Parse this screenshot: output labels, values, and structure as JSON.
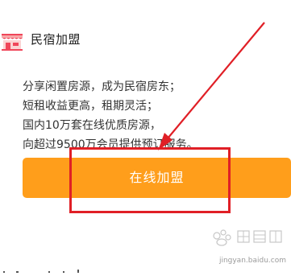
{
  "card": {
    "title": "民宿加盟",
    "description_lines": [
      "分享闲置房源，成为民宿房东；",
      "短租收益更高，租期灵活；",
      "国内10万套在线优质房源，",
      "向超过9500万会员提供预订服务。"
    ],
    "join_button_label": "在线加盟"
  },
  "colors": {
    "button_bg": "#ff9e1b",
    "annotation_red": "#e01f26",
    "icon_accent": "#f0465a"
  },
  "icons": {
    "card_icon": "shop-icon",
    "watermark": "baidu-jingyan-logo"
  },
  "watermark": {
    "text": "jingyan.baidu.com"
  }
}
